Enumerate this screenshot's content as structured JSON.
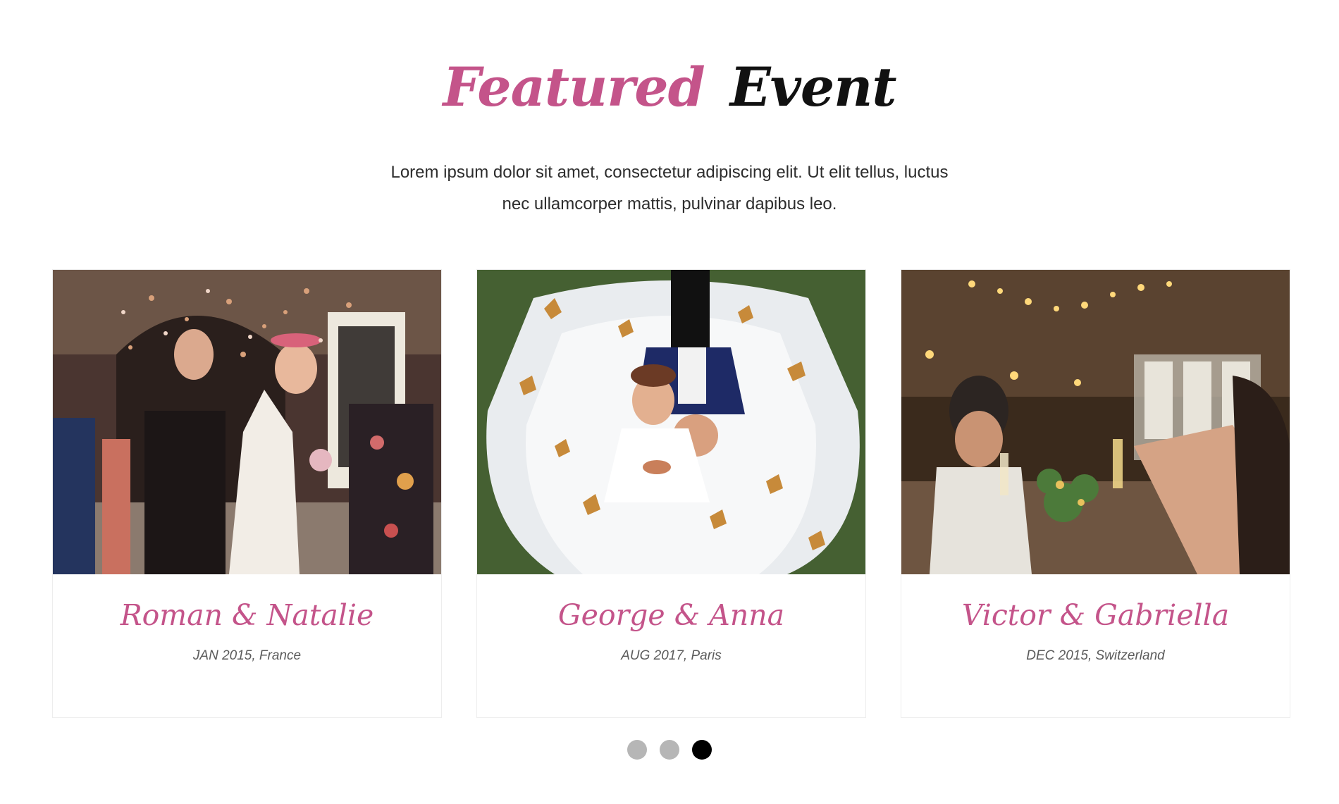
{
  "section": {
    "title_part1": "Featured",
    "title_part2": "Event",
    "intro_line1": "Lorem ipsum dolor sit amet, consectetur adipiscing elit. Ut elit tellus, luctus",
    "intro_line2": "nec ullamcorper mattis, pulvinar dapibus leo."
  },
  "events": [
    {
      "couple": "Roman & Natalie",
      "meta": "JAN 2015, France"
    },
    {
      "couple": "George & Anna",
      "meta": "AUG 2017, Paris"
    },
    {
      "couple": "Victor & Gabriella",
      "meta": "DEC 2015, Switzerland"
    }
  ],
  "carousel": {
    "pages": 3,
    "active_page": 3
  },
  "colors": {
    "accent": "#c4548a",
    "title_dark": "#111111",
    "dot_inactive": "#b6b6b6",
    "dot_active": "#000000"
  }
}
